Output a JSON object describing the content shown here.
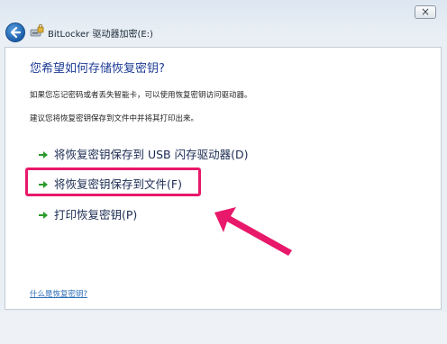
{
  "window": {
    "title": "BitLocker 驱动器加密(E:)",
    "close_label": "×"
  },
  "main": {
    "heading": "您希望如何存储恢复密钥?",
    "description_1": "如果您忘记密码或者丢失智能卡，可以使用恢复密钥访问驱动器。",
    "description_2": "建议您将恢复密钥保存到文件中并将其打印出来。",
    "options": [
      {
        "label": "将恢复密钥保存到 USB 闪存驱动器(D)",
        "icon": "green-arrow-icon"
      },
      {
        "label": "将恢复密钥保存到文件(F)",
        "icon": "green-arrow-icon"
      },
      {
        "label": "打印恢复密钥(P)",
        "icon": "green-arrow-icon"
      }
    ],
    "help_link": "什么是恢复密钥?"
  },
  "colors": {
    "heading": "#1e3c96",
    "highlight": "#e8186a",
    "arrow": "#2a9a2a",
    "link": "#2c6eb8"
  }
}
